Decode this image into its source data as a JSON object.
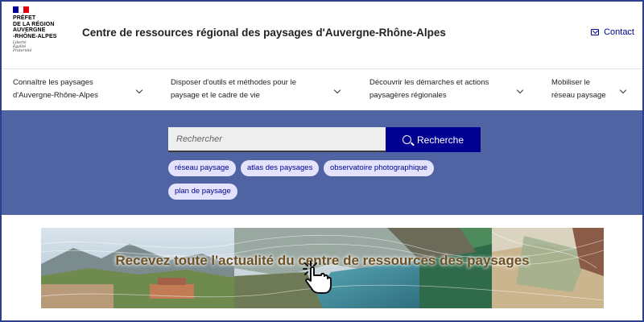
{
  "header": {
    "logo": {
      "lines": [
        "PRÉFET",
        "DE LA RÉGION",
        "AUVERGNE",
        "-RHÔNE-ALPES"
      ],
      "motto": [
        "Liberté",
        "Égalité",
        "Fraternité"
      ],
      "flag_colors": [
        "#000091",
        "#ffffff",
        "#e1000f"
      ]
    },
    "site_title": "Centre de ressources régional des paysages d'Auvergne-Rhône-Alpes",
    "contact_label": "Contact",
    "contact_icon": "mail-icon"
  },
  "nav": {
    "items": [
      {
        "line1": "Connaître les paysages",
        "line2": "d'Auvergne-Rhône-Alpes"
      },
      {
        "line1": "Disposer d'outils et méthodes pour le",
        "line2": "paysage et le cadre de vie"
      },
      {
        "line1": "Découvrir les démarches et actions",
        "line2": "paysagères régionales"
      },
      {
        "line1": "Mobiliser le",
        "line2": "réseau paysage"
      }
    ]
  },
  "search": {
    "placeholder": "Rechercher",
    "button_label": "Recherche",
    "tags": [
      "réseau paysage",
      "atlas des paysages",
      "observatoire photographique",
      "plan de paysage"
    ]
  },
  "banner": {
    "title": "Recevez toute l'actualité du centre de ressources des paysages"
  },
  "colors": {
    "accent": "#000091",
    "band": "#5064a4",
    "tag_bg": "#e3e3fd",
    "banner_text": "#6e5226"
  }
}
